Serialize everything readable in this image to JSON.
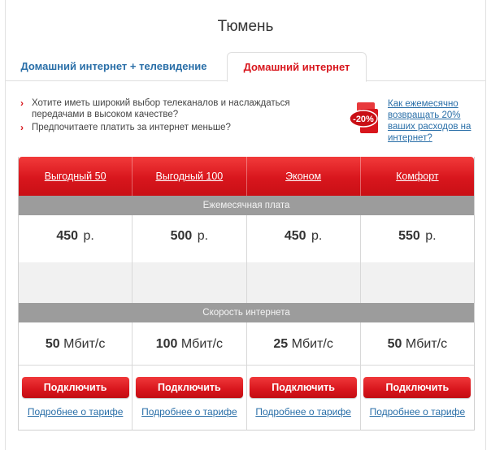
{
  "header": {
    "city": "Тюмень"
  },
  "tabs": [
    {
      "label": "Домашний интернет + телевидение",
      "active": false
    },
    {
      "label": "Домашний интернет",
      "active": true
    }
  ],
  "promo": {
    "bullets": [
      "Хотите иметь широкий выбор телеканалов и наслаждаться передачами в высоком качестве?",
      "Предпочитаете платить за интернет меньше?"
    ],
    "badge_text": "-20%",
    "link_text": "Как ежемесячно возвращать 20% ваших расходов на интернет?"
  },
  "table": {
    "plans": [
      {
        "name": "Выгодный 50",
        "price": "450",
        "price_unit": "р.",
        "speed": "50",
        "speed_unit": "Мбит/с"
      },
      {
        "name": "Выгодный 100",
        "price": "500",
        "price_unit": "р.",
        "speed": "100",
        "speed_unit": "Мбит/с"
      },
      {
        "name": "Эконом",
        "price": "450",
        "price_unit": "р.",
        "speed": "25",
        "speed_unit": "Мбит/с"
      },
      {
        "name": "Комфорт",
        "price": "550",
        "price_unit": "р.",
        "speed": "50",
        "speed_unit": "Мбит/с"
      }
    ],
    "section_monthly": "Ежемесячная плата",
    "section_speed": "Скорость интернета",
    "connect_label": "Подключить",
    "details_label": "Подробнее о тарифе"
  },
  "colors": {
    "brand_red": "#d8161d",
    "link_blue": "#2a6fa8",
    "section_gray": "#9c9c9c"
  }
}
